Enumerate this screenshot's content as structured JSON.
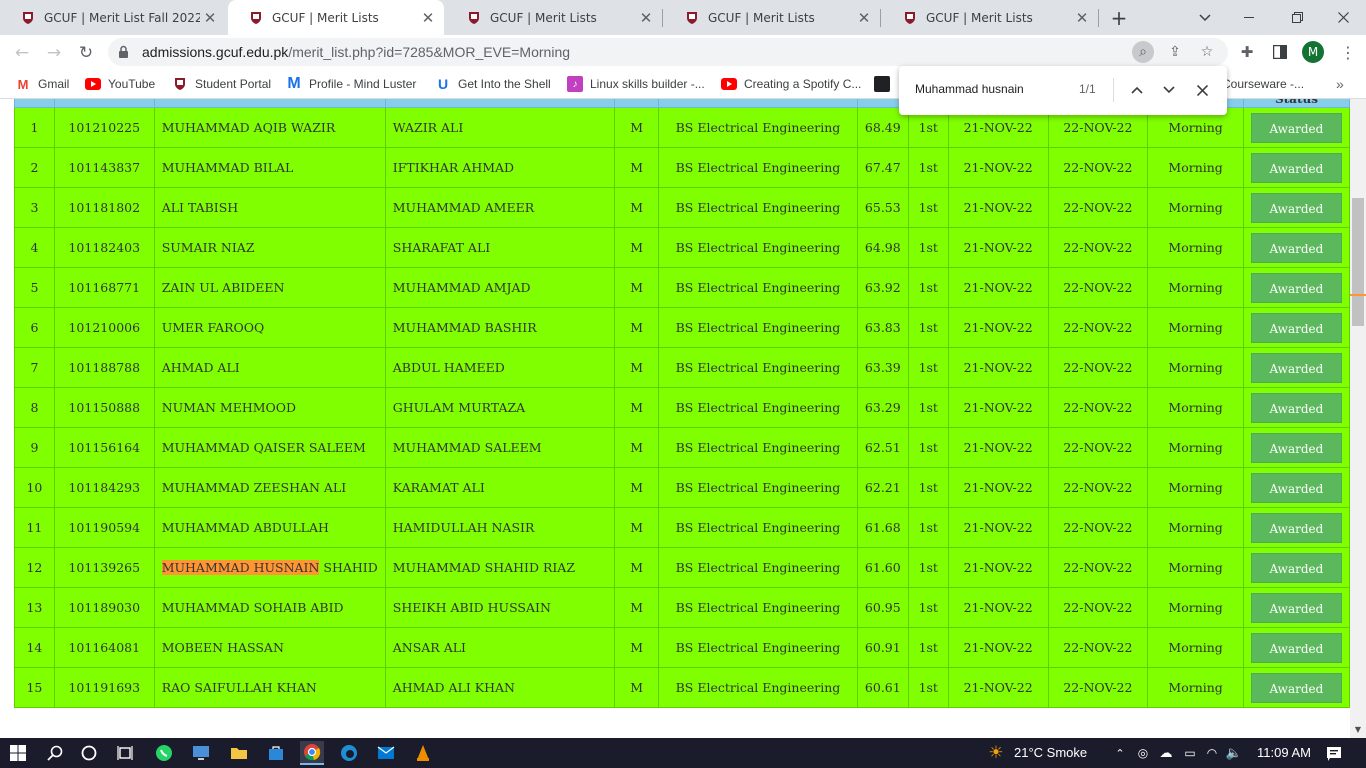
{
  "browser": {
    "tabs": [
      {
        "title": "GCUF | Merit List Fall 2022"
      },
      {
        "title": "GCUF | Merit Lists"
      },
      {
        "title": "GCUF | Merit Lists"
      },
      {
        "title": "GCUF | Merit Lists"
      },
      {
        "title": "GCUF | Merit Lists"
      }
    ],
    "url_domain": "admissions.gcuf.edu.pk",
    "url_path": "/merit_list.php?id=7285&MOR_EVE=Morning",
    "profile_initial": "M",
    "bookmarks": [
      {
        "label": "Gmail"
      },
      {
        "label": "YouTube"
      },
      {
        "label": "Student Portal"
      },
      {
        "label": "Profile - Mind Luster"
      },
      {
        "label": "Get Into the Shell"
      },
      {
        "label": "Linux skills builder -..."
      },
      {
        "label": "Creating a Spotify C..."
      },
      {
        "label": "Courseware -..."
      }
    ]
  },
  "find_bar": {
    "query": "Muhammad husnain",
    "count": "1/1"
  },
  "table": {
    "header_status": "Status",
    "rows": [
      {
        "sr": "1",
        "app_no": "101210225",
        "name": "MUHAMMAD AQIB WAZIR",
        "father": "WAZIR ALI",
        "gender": "M",
        "program": "BS Electrical Engineering",
        "merit": "68.49",
        "list": "1st",
        "start": "21-NOV-22",
        "end": "22-NOV-22",
        "shift": "Morning",
        "status": "Awarded"
      },
      {
        "sr": "2",
        "app_no": "101143837",
        "name": "MUHAMMAD BILAL",
        "father": "IFTIKHAR AHMAD",
        "gender": "M",
        "program": "BS Electrical Engineering",
        "merit": "67.47",
        "list": "1st",
        "start": "21-NOV-22",
        "end": "22-NOV-22",
        "shift": "Morning",
        "status": "Awarded"
      },
      {
        "sr": "3",
        "app_no": "101181802",
        "name": "ALI TABISH",
        "father": "MUHAMMAD AMEER",
        "gender": "M",
        "program": "BS Electrical Engineering",
        "merit": "65.53",
        "list": "1st",
        "start": "21-NOV-22",
        "end": "22-NOV-22",
        "shift": "Morning",
        "status": "Awarded"
      },
      {
        "sr": "4",
        "app_no": "101182403",
        "name": "SUMAIR NIAZ",
        "father": "SHARAFAT ALI",
        "gender": "M",
        "program": "BS Electrical Engineering",
        "merit": "64.98",
        "list": "1st",
        "start": "21-NOV-22",
        "end": "22-NOV-22",
        "shift": "Morning",
        "status": "Awarded"
      },
      {
        "sr": "5",
        "app_no": "101168771",
        "name": "ZAIN UL ABIDEEN",
        "father": "MUHAMMAD AMJAD",
        "gender": "M",
        "program": "BS Electrical Engineering",
        "merit": "63.92",
        "list": "1st",
        "start": "21-NOV-22",
        "end": "22-NOV-22",
        "shift": "Morning",
        "status": "Awarded"
      },
      {
        "sr": "6",
        "app_no": "101210006",
        "name": "UMER FAROOQ",
        "father": "MUHAMMAD BASHIR",
        "gender": "M",
        "program": "BS Electrical Engineering",
        "merit": "63.83",
        "list": "1st",
        "start": "21-NOV-22",
        "end": "22-NOV-22",
        "shift": "Morning",
        "status": "Awarded"
      },
      {
        "sr": "7",
        "app_no": "101188788",
        "name": "AHMAD ALI",
        "father": "ABDUL HAMEED",
        "gender": "M",
        "program": "BS Electrical Engineering",
        "merit": "63.39",
        "list": "1st",
        "start": "21-NOV-22",
        "end": "22-NOV-22",
        "shift": "Morning",
        "status": "Awarded"
      },
      {
        "sr": "8",
        "app_no": "101150888",
        "name": "NUMAN MEHMOOD",
        "father": "GHULAM MURTAZA",
        "gender": "M",
        "program": "BS Electrical Engineering",
        "merit": "63.29",
        "list": "1st",
        "start": "21-NOV-22",
        "end": "22-NOV-22",
        "shift": "Morning",
        "status": "Awarded"
      },
      {
        "sr": "9",
        "app_no": "101156164",
        "name": "MUHAMMAD QAISER SALEEM",
        "father": "MUHAMMAD SALEEM",
        "gender": "M",
        "program": "BS Electrical Engineering",
        "merit": "62.51",
        "list": "1st",
        "start": "21-NOV-22",
        "end": "22-NOV-22",
        "shift": "Morning",
        "status": "Awarded"
      },
      {
        "sr": "10",
        "app_no": "101184293",
        "name": "MUHAMMAD ZEESHAN ALI",
        "father": "KARAMAT ALI",
        "gender": "M",
        "program": "BS Electrical Engineering",
        "merit": "62.21",
        "list": "1st",
        "start": "21-NOV-22",
        "end": "22-NOV-22",
        "shift": "Morning",
        "status": "Awarded"
      },
      {
        "sr": "11",
        "app_no": "101190594",
        "name": "MUHAMMAD ABDULLAH",
        "father": "HAMIDULLAH NASIR",
        "gender": "M",
        "program": "BS Electrical Engineering",
        "merit": "61.68",
        "list": "1st",
        "start": "21-NOV-22",
        "end": "22-NOV-22",
        "shift": "Morning",
        "status": "Awarded"
      },
      {
        "sr": "12",
        "app_no": "101139265",
        "name_highlight": "MUHAMMAD HUSNAIN",
        "name_rest": " SHAHID",
        "father": "MUHAMMAD SHAHID RIAZ",
        "gender": "M",
        "program": "BS Electrical Engineering",
        "merit": "61.60",
        "list": "1st",
        "start": "21-NOV-22",
        "end": "22-NOV-22",
        "shift": "Morning",
        "status": "Awarded"
      },
      {
        "sr": "13",
        "app_no": "101189030",
        "name": "MUHAMMAD SOHAIB ABID",
        "father": "SHEIKH ABID HUSSAIN",
        "gender": "M",
        "program": "BS Electrical Engineering",
        "merit": "60.95",
        "list": "1st",
        "start": "21-NOV-22",
        "end": "22-NOV-22",
        "shift": "Morning",
        "status": "Awarded"
      },
      {
        "sr": "14",
        "app_no": "101164081",
        "name": "MOBEEN HASSAN",
        "father": "ANSAR ALI",
        "gender": "M",
        "program": "BS Electrical Engineering",
        "merit": "60.91",
        "list": "1st",
        "start": "21-NOV-22",
        "end": "22-NOV-22",
        "shift": "Morning",
        "status": "Awarded"
      },
      {
        "sr": "15",
        "app_no": "101191693",
        "name": "RAO SAIFULLAH KHAN",
        "father": "AHMAD ALI KHAN",
        "gender": "M",
        "program": "BS Electrical Engineering",
        "merit": "60.61",
        "list": "1st",
        "start": "21-NOV-22",
        "end": "22-NOV-22",
        "shift": "Morning",
        "status": "Awarded"
      }
    ]
  },
  "taskbar": {
    "weather": "21°C  Smoke",
    "time": "11:09 AM"
  },
  "colors": {
    "row_bg": "#7fff00",
    "header_bg": "#87ceeb",
    "awarded_bg": "#5cb85c",
    "highlight": "#ff9632"
  }
}
